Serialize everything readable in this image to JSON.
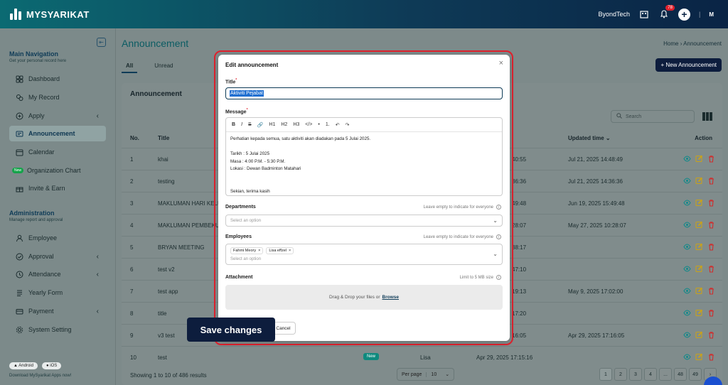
{
  "app": {
    "brand": "MYSYARIKAT",
    "company": "ByondTech",
    "notif_count": "78",
    "user_initials": "M"
  },
  "sidebar": {
    "main_title": "Main Navigation",
    "main_sub": "Get your personal record here",
    "items": [
      {
        "label": "Dashboard",
        "icon": "dashboard-icon"
      },
      {
        "label": "My Record",
        "icon": "record-icon"
      },
      {
        "label": "Apply",
        "icon": "apply-icon"
      },
      {
        "label": "Announcement",
        "icon": "announcement-icon"
      },
      {
        "label": "Calendar",
        "icon": "calendar-icon"
      },
      {
        "label": "Organization Chart",
        "icon": "org-chart-icon",
        "badge": "New"
      },
      {
        "label": "Invite & Earn",
        "icon": "gift-icon"
      }
    ],
    "admin_title": "Administration",
    "admin_sub": "Manage report and approval",
    "admin_items": [
      {
        "label": "Employee",
        "icon": "employee-icon"
      },
      {
        "label": "Approval",
        "icon": "approval-icon"
      },
      {
        "label": "Attendance",
        "icon": "attendance-icon"
      },
      {
        "label": "Yearly Form",
        "icon": "form-icon"
      },
      {
        "label": "Payment",
        "icon": "payment-icon"
      },
      {
        "label": "System Setting",
        "icon": "settings-icon"
      }
    ],
    "android": "Android",
    "ios": "iOS",
    "apps_text": "Download MySyarikat Apps now!"
  },
  "main": {
    "page_title": "Announcement",
    "breadcrumb_home": "Home",
    "breadcrumb_current": "Announcement",
    "tabs": [
      "All",
      "Unread"
    ],
    "new_button": "New Announcement",
    "card_title": "Announcement",
    "search_placeholder": "Search",
    "columns": {
      "no": "No.",
      "title": "Title",
      "updated": "Updated time",
      "action": "Action"
    },
    "rows": [
      {
        "no": "1",
        "title": "khai",
        "created_frag": "40:55",
        "updated": "Jul 21, 2025 14:48:49"
      },
      {
        "no": "2",
        "title": "testing",
        "created_frag": "36:36",
        "updated": "Jul 21, 2025 14:36:36"
      },
      {
        "no": "3",
        "title": "MAKLUMAN HARI KELUA",
        "created_frag": "49:48",
        "updated": "Jun 19, 2025 15:49:48"
      },
      {
        "no": "4",
        "title": "MAKLUMAN PEMBEKUA",
        "created_frag": "28:07",
        "updated": "May 27, 2025 10:28:07"
      },
      {
        "no": "5",
        "title": "BRYAN MEETING",
        "created_frag": "38:17",
        "updated": ""
      },
      {
        "no": "6",
        "title": "test v2",
        "created_frag": "47:10",
        "updated": ""
      },
      {
        "no": "7",
        "title": "test app",
        "created_frag": "19:13",
        "updated": "May 9, 2025 17:02:00"
      },
      {
        "no": "8",
        "title": "title",
        "created_frag": "17:20",
        "updated": ""
      },
      {
        "no": "9",
        "title": "v3 test",
        "created_frag": "16:05",
        "updated": "Apr 29, 2025 17:16:05"
      },
      {
        "no": "10",
        "title": "test",
        "created_frag": "Apr 29, 2025 17:15:16",
        "updated": "",
        "badge": "New",
        "author": "Lisa"
      }
    ],
    "footer_text": "Showing 1 to 10 of 486 results",
    "per_page_label": "Per page",
    "per_page_value": "10",
    "pages": [
      "1",
      "2",
      "3",
      "4",
      "...",
      "48",
      "49"
    ]
  },
  "modal": {
    "title": "Edit announcement",
    "title_label": "Title",
    "title_value": "Aktiviti Pejabat",
    "message_label": "Message",
    "toolbar": [
      "B",
      "I",
      "S",
      "🔗",
      "H1",
      "H2",
      "H3",
      "</>",
      "•",
      "1.",
      "↶",
      "↷"
    ],
    "message_lines": [
      "Perhatian kepada semua, satu aktiviti akan diadakan pada 5 Julai 2025.",
      "",
      "Tarikh : 5 Julai 2025",
      "Masa : 4:00 P.M. - 5:30 P.M.",
      "Lokasi : Dewan Badminton Matahari",
      "",
      "",
      "Sekian, terima kasih"
    ],
    "departments_label": "Departments",
    "departments_hint": "Leave empty to indicate for everyone",
    "departments_placeholder": "Select an option",
    "employees_label": "Employees",
    "employees_hint": "Leave empty to indicate for everyone",
    "employees_chips": [
      "Fahmi Meory",
      "Lisa effzel"
    ],
    "employees_placeholder": "Select an option",
    "attachment_label": "Attachment",
    "attachment_hint": "Limit to 5 MB size",
    "drop_text": "Drag & Drop your files or",
    "browse": "Browse",
    "cancel": "Cancel",
    "save": "Save changes"
  }
}
